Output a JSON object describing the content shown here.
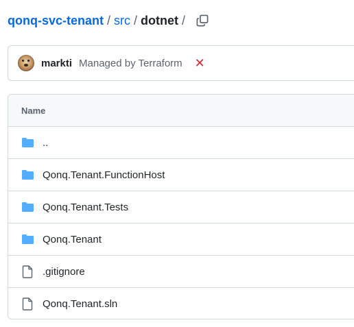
{
  "breadcrumb": {
    "repo": "qonq-svc-tenant",
    "sep1": "/",
    "folder": "src",
    "sep2": "/",
    "current": "dotnet",
    "sep3": "/"
  },
  "commit": {
    "author": "markti",
    "message": "Managed by Terraform",
    "status_icon": "x-icon",
    "status_symbol": "✕"
  },
  "table": {
    "header": "Name",
    "rows": [
      {
        "name": "..",
        "type": "folder"
      },
      {
        "name": "Qonq.Tenant.FunctionHost",
        "type": "folder"
      },
      {
        "name": "Qonq.Tenant.Tests",
        "type": "folder"
      },
      {
        "name": "Qonq.Tenant",
        "type": "folder"
      },
      {
        "name": ".gitignore",
        "type": "file"
      },
      {
        "name": "Qonq.Tenant.sln",
        "type": "file"
      }
    ]
  },
  "colors": {
    "link": "#0969da",
    "folder": "#54aeff",
    "error": "#d1242f"
  }
}
